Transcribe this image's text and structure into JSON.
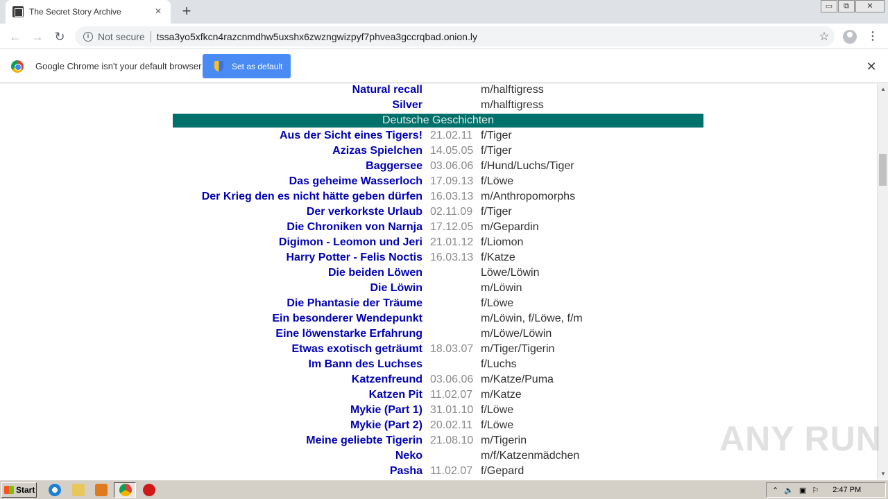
{
  "browser": {
    "tab_title": "The Secret Story Archive",
    "tab_close": "×",
    "new_tab": "+",
    "security_label": "Not secure",
    "url": "tssa3yo5xfkcn4razcnmdhw5uxshx6zwzngwizpyf7phvea3gccrqbad.onion.ly",
    "star": "☆",
    "menu": "⋮",
    "back": "←",
    "forward": "→",
    "reload": "↻",
    "window_controls": {
      "minimize": "▭",
      "maximize": "⧉",
      "close": "✕"
    }
  },
  "infobar": {
    "message": "Google Chrome isn't your default browser",
    "button_label": "Set as default",
    "close": "✕"
  },
  "stories_before": [
    {
      "title": "Natural recall",
      "date": "",
      "category": "m/halftigress"
    },
    {
      "title": "Silver",
      "date": "",
      "category": "m/halftigress"
    }
  ],
  "section_title": "Deutsche Geschichten",
  "stories": [
    {
      "title": "Aus der Sicht eines Tigers!",
      "date": "21.02.11",
      "category": "f/Tiger"
    },
    {
      "title": "Azizas Spielchen",
      "date": "14.05.05",
      "category": "f/Tiger"
    },
    {
      "title": "Baggersee",
      "date": "03.06.06",
      "category": "f/Hund/Luchs/Tiger"
    },
    {
      "title": "Das geheime Wasserloch",
      "date": "17.09.13",
      "category": "f/Löwe"
    },
    {
      "title": "Der Krieg den es nicht hätte geben dürfen",
      "date": "16.03.13",
      "category": "m/Anthropomorphs"
    },
    {
      "title": "Der verkorkste Urlaub",
      "date": "02.11.09",
      "category": "f/Tiger"
    },
    {
      "title": "Die Chroniken von Narnja",
      "date": "17.12.05",
      "category": "m/Gepardin"
    },
    {
      "title": "Digimon - Leomon und Jeri",
      "date": "21.01.12",
      "category": "f/Liomon"
    },
    {
      "title": "Harry Potter - Felis Noctis",
      "date": "16.03.13",
      "category": "f/Katze"
    },
    {
      "title": "Die beiden Löwen",
      "date": "",
      "category": "Löwe/Löwin"
    },
    {
      "title": "Die Löwin",
      "date": "",
      "category": "m/Löwin"
    },
    {
      "title": "Die Phantasie der Träume",
      "date": "",
      "category": "f/Löwe"
    },
    {
      "title": "Ein besonderer Wendepunkt",
      "date": "",
      "category": "m/Löwin, f/Löwe, f/m"
    },
    {
      "title": "Eine löwenstarke Erfahrung",
      "date": "",
      "category": "m/Löwe/Löwin"
    },
    {
      "title": "Etwas exotisch geträumt",
      "date": "18.03.07",
      "category": "m/Tiger/Tigerin"
    },
    {
      "title": "Im Bann des Luchses",
      "date": "",
      "category": "f/Luchs"
    },
    {
      "title": "Katzenfreund",
      "date": "03.06.06",
      "category": "m/Katze/Puma"
    },
    {
      "title": "Katzen Pit",
      "date": "11.02.07",
      "category": "m/Katze"
    },
    {
      "title": "Mykie (Part 1)",
      "date": "31.01.10",
      "category": "f/Löwe"
    },
    {
      "title": "Mykie (Part 2)",
      "date": "20.02.11",
      "category": "f/Löwe"
    },
    {
      "title": "Meine geliebte Tigerin",
      "date": "21.08.10",
      "category": "m/Tigerin"
    },
    {
      "title": "Neko",
      "date": "",
      "category": "m/f/Katzenmädchen"
    },
    {
      "title": "Pasha",
      "date": "11.02.07",
      "category": "f/Gepard"
    }
  ],
  "watermark": "ANY RUN",
  "taskbar": {
    "start_label": "Start",
    "tray_arrow": "⌃",
    "time": "2:47 PM"
  },
  "colors": {
    "link": "#0000b4",
    "section_bg": "#00706a",
    "date": "#8a8a8a",
    "button_blue": "#4a8af4"
  }
}
